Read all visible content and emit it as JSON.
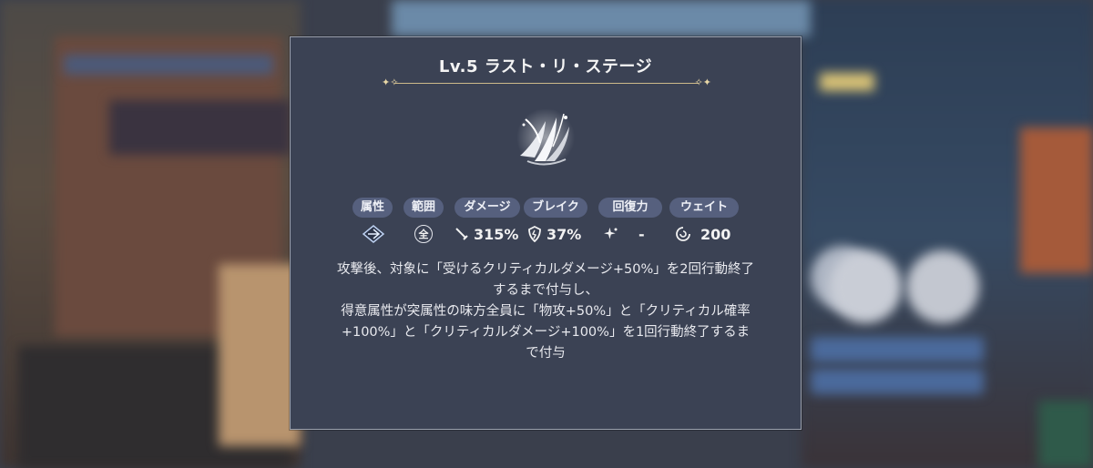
{
  "skill": {
    "title": "Lv.5 ラスト・リ・ステージ",
    "icon": "feather-burst-icon"
  },
  "stats": [
    {
      "label": "属性",
      "value": "",
      "icon": "element-diamond-icon"
    },
    {
      "label": "範囲",
      "value": "",
      "icon": "range-all-icon",
      "icon_text": "全"
    },
    {
      "label": "ダメージ",
      "value": "315%",
      "icon": "sword-icon"
    },
    {
      "label": "ブレイク",
      "value": "37%",
      "icon": "shield-break-icon"
    },
    {
      "label": "回復力",
      "value": "-",
      "icon": "sparkle-icon"
    },
    {
      "label": "ウェイト",
      "value": "200",
      "icon": "wait-swirl-icon"
    }
  ],
  "description": [
    "攻撃後、対象に「受けるクリティカルダメージ+50%」を2回行動終了",
    "するまで付与し、",
    "得意属性が突属性の味方全員に「物攻+50%」と「クリティカル確率",
    "+100%」と「クリティカルダメージ+100%」を1回行動終了するま",
    "で付与"
  ],
  "colors": {
    "panel_bg": "#3b4254",
    "pill_bg": "#56607e",
    "divider_gold": "#cdb98a"
  }
}
